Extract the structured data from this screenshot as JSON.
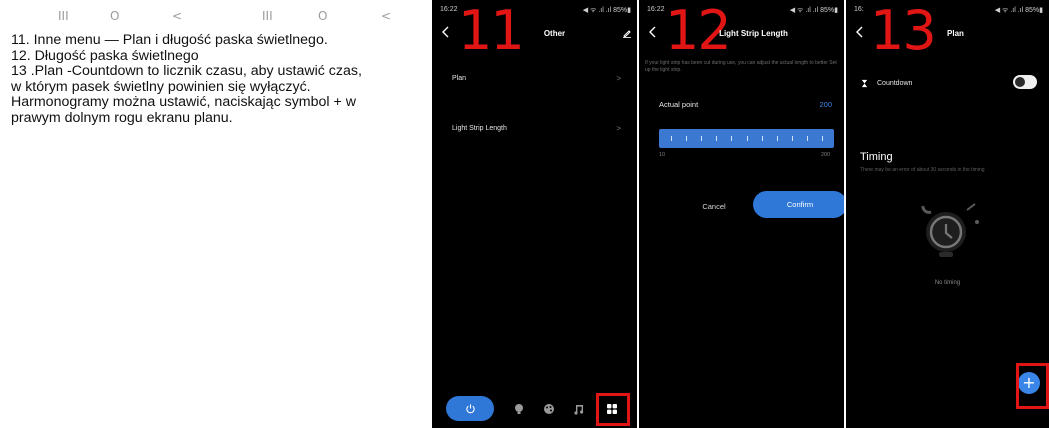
{
  "nav_bar": {
    "glyphs": [
      "III",
      "O",
      "<",
      "III",
      "O",
      "<"
    ]
  },
  "instructions": {
    "lines": [
      "11. Inne menu — Plan i długość paska świetlnego.",
      "12. Długość paska świetlnego",
      "13 .Plan -Countdown to licznik czasu, aby ustawić czas,",
      "w którym pasek świetlny powinien się wyłączyć.",
      "Harmonogramy można ustawić, naciskając symbol + w",
      "prawym dolnym rogu ekranu planu."
    ]
  },
  "phones": {
    "p11": {
      "status_time": "16:22",
      "status_icons": "◀ ᯤ .ıl .ıl 85%▮",
      "step_number": "11",
      "title": "Other",
      "menu": [
        {
          "label": "Plan",
          "chevron": ">"
        },
        {
          "label": "Light Strip Length",
          "chevron": ">"
        }
      ],
      "bottom_nav": [
        "power-icon",
        "bulb-icon",
        "palette-icon",
        "music-icon",
        "grid-icon"
      ]
    },
    "p12": {
      "status_time": "16:22",
      "status_icons": "◀ ᯤ .ıl .ıl 85%▮",
      "step_number": "12",
      "title": "Light Strip Length",
      "description": "If your light strip has been cut during use, you can adjust the actual length to better Set up the light strip.",
      "actual_point_label": "Actual point",
      "actual_point_value": "200",
      "slider": {
        "min_label": "10",
        "max_label": "200",
        "value": 200,
        "min": 10,
        "max": 200
      },
      "cancel_label": "Cancel",
      "confirm_label": "Confirm"
    },
    "p13": {
      "status_time": "16:",
      "status_icons": "◀ ᯤ .ıl .ıl 85%▮",
      "step_number": "13",
      "title": "Plan",
      "countdown_label": "Countdown",
      "countdown_on": false,
      "timing_title": "Timing",
      "timing_subtitle": "There may be an error of about 30 seconds in the timing",
      "empty_text": "No timing",
      "add_label": "+"
    }
  },
  "colors": {
    "accent_blue": "#2f78d8",
    "highlight_red": "#e01515",
    "phone_bg": "#000000"
  }
}
